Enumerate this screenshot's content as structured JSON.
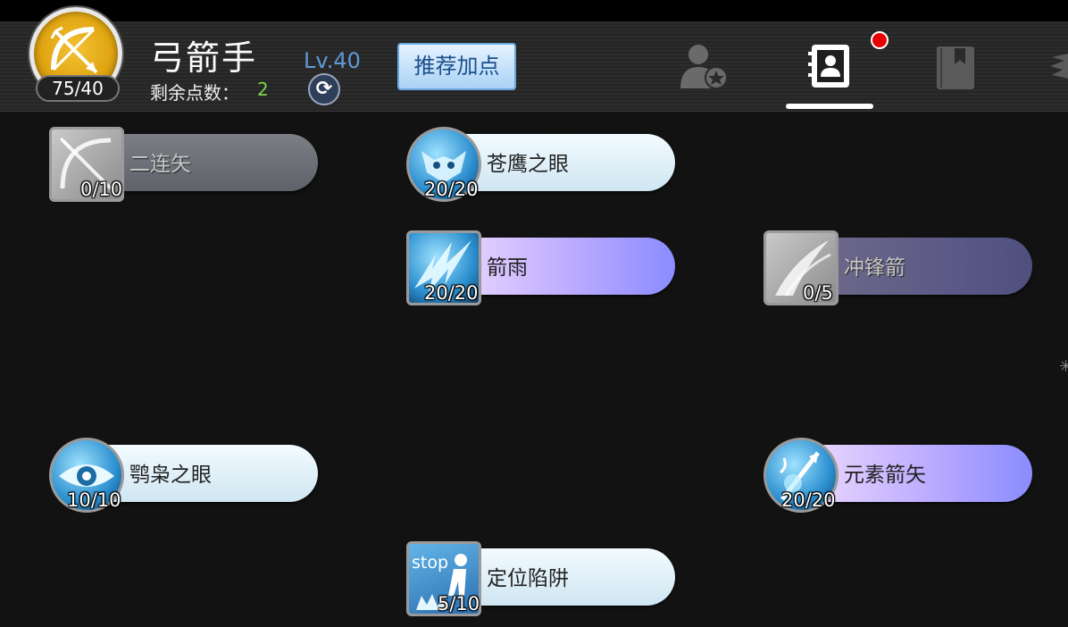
{
  "header": {
    "class_name": "弓箭手",
    "skill_points": "75/40",
    "remaining_label": "剩余点数：",
    "remaining_value": "2",
    "level": "Lv.40",
    "recommend_label": "推荐加点",
    "tabs": [
      {
        "icon": "user-star-icon",
        "active": false
      },
      {
        "icon": "contact-book-icon",
        "active": true,
        "has_notification": true
      },
      {
        "icon": "bookmark-book-icon",
        "active": false
      },
      {
        "icon": "wing-icon",
        "active": false
      }
    ]
  },
  "skills": [
    {
      "name": "二连矢",
      "level": "0/10",
      "icon": "double-arrow-bow-icon",
      "style": "locked"
    },
    {
      "name": "苍鹰之眼",
      "level": "20/20",
      "icon": "hawk-eye-icon",
      "style": "learned"
    },
    {
      "name": "箭雨",
      "level": "20/20",
      "icon": "arrow-rain-icon",
      "style": "learned"
    },
    {
      "name": "冲锋箭",
      "level": "0/5",
      "icon": "charge-arrow-icon",
      "style": "locked"
    },
    {
      "name": "鹗枭之眼",
      "level": "10/10",
      "icon": "owl-eye-icon",
      "style": "learned"
    },
    {
      "name": "元素箭矢",
      "level": "20/20",
      "icon": "elemental-arrow-icon",
      "style": "learned"
    },
    {
      "name": "定位陷阱",
      "level": "5/10",
      "icon": "stop-trap-icon",
      "icon_text": "stop",
      "style": "learned"
    }
  ],
  "colors": {
    "accent_blue": "#5f9ad6",
    "remaining_green": "#7fd34a",
    "notification_red": "#e80000",
    "emblem_gold": "#e1a511"
  }
}
